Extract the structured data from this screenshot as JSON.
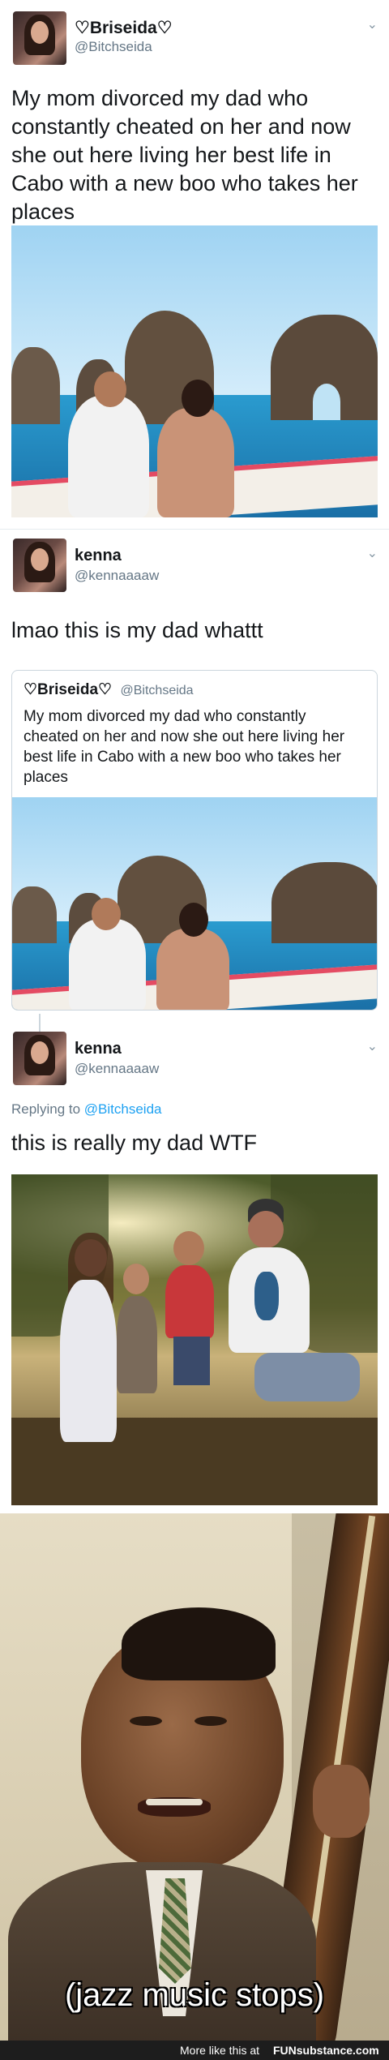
{
  "tweet1": {
    "name": "♡Briseida♡",
    "handle": "@Bitchseida",
    "text": "My mom divorced my dad who constantly cheated on her and now she out here living her best life in Cabo with a new boo who takes her places",
    "chevron": "⌄"
  },
  "tweet2": {
    "name": "kenna",
    "handle": "@kennaaaaw",
    "text": "lmao this is my dad whattt",
    "chevron": "⌄",
    "quote": {
      "name": "♡Briseida♡",
      "handle": "@Bitchseida",
      "text": "My mom divorced my dad who constantly cheated on her and now she out here living her best life in Cabo with a new boo who takes her places"
    }
  },
  "tweet3": {
    "name": "kenna",
    "handle": "@kennaaaaw",
    "replying_prefix": "Replying to",
    "replying_handle": "@Bitchseida",
    "text": "this is really my dad WTF",
    "chevron": "⌄"
  },
  "meme": {
    "caption": "(jazz music stops)"
  },
  "footer": {
    "text": "More like this at",
    "brand": "FUNsubstance.com"
  },
  "colors": {
    "link": "#1da1f2",
    "handle": "#657786",
    "boat_stripe": "#e44b63",
    "sea": "#2a9bcf"
  }
}
